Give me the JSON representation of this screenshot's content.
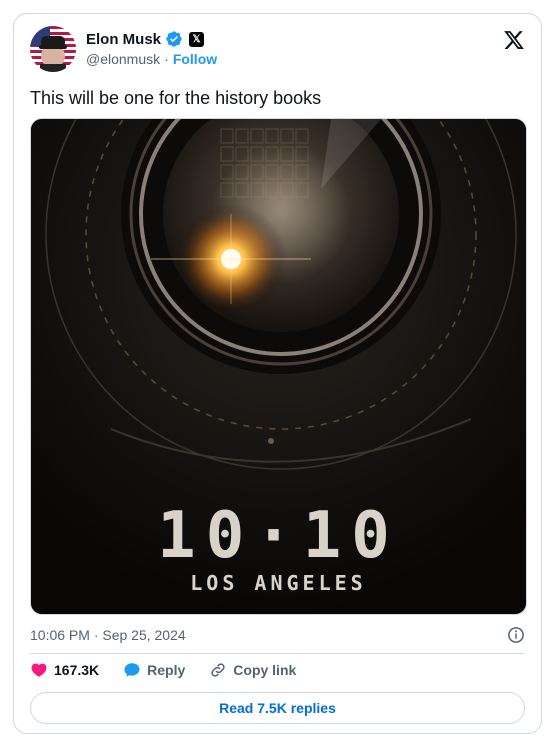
{
  "author": {
    "name": "Elon Musk",
    "handle": "@elonmusk",
    "separator": "·",
    "follow_label": "Follow",
    "x_badge": "𝕏"
  },
  "tweet": {
    "text": "This will be one for the history books",
    "media": {
      "title": "10·10",
      "subtitle": "LOS ANGELES"
    },
    "timestamp": "10:06 PM · Sep 25, 2024"
  },
  "actions": {
    "likes": "167.3K",
    "reply_label": "Reply",
    "copy_link_label": "Copy link",
    "read_replies_label": "Read 7.5K replies"
  },
  "colors": {
    "accent": "#1d9bf0",
    "like": "#f91880",
    "link": "#006fd6",
    "border": "#cfd9de",
    "muted": "#536471"
  },
  "icons": {
    "verified": "verified-badge-icon",
    "logo": "x-logo-icon",
    "info": "info-icon",
    "like": "heart-icon",
    "reply": "speech-bubble-icon",
    "copy": "link-icon"
  }
}
